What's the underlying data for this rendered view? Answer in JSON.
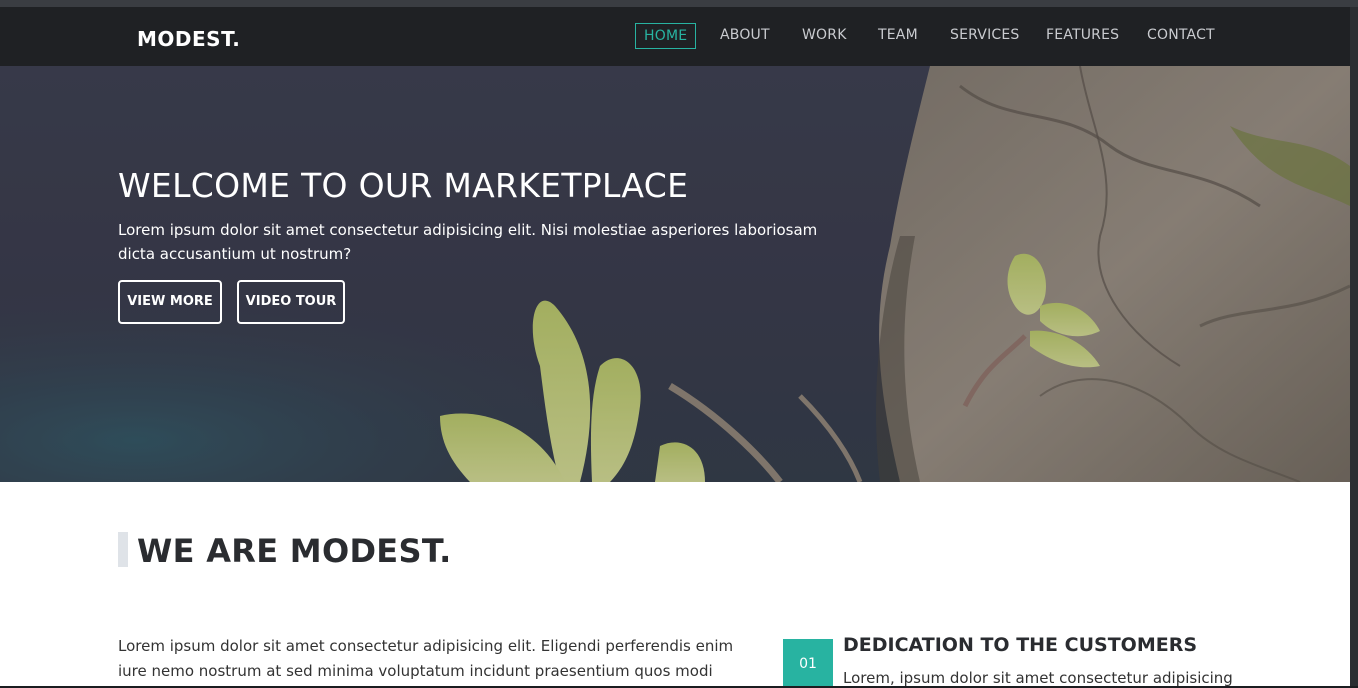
{
  "navbar": {
    "logo": "MODEST.",
    "items": [
      {
        "label": "HOME",
        "active": true
      },
      {
        "label": "ABOUT",
        "active": false
      },
      {
        "label": "WORK",
        "active": false
      },
      {
        "label": "TEAM",
        "active": false
      },
      {
        "label": "SERVICES",
        "active": false
      },
      {
        "label": "FEATURES",
        "active": false
      },
      {
        "label": "CONTACT",
        "active": false
      }
    ]
  },
  "hero": {
    "title": "WELCOME TO OUR MARKETPLACE",
    "text": "Lorem ipsum dolor sit amet consectetur adipisicing elit. Nisi molestiae asperiores laboriosam dicta accusantium ut nostrum?",
    "buttons": {
      "primary": "VIEW MORE",
      "secondary": "VIDEO TOUR"
    }
  },
  "about": {
    "title": "WE ARE MODEST.",
    "paragraph": "Lorem ipsum dolor sit amet consectetur adipisicing elit. Eligendi perferendis enim iure nemo nostrum at sed minima voluptatum incidunt praesentium quos modi dolorum, ab",
    "feature": {
      "number": "01",
      "title": "DEDICATION TO THE CUSTOMERS",
      "text": "Lorem, ipsum dolor sit amet consectetur adipisicing"
    }
  },
  "colors": {
    "accent": "#28b3a1",
    "navbar": "#1f2124",
    "hero_overlay": "#363847"
  },
  "icons": [
    "logo-mark"
  ]
}
